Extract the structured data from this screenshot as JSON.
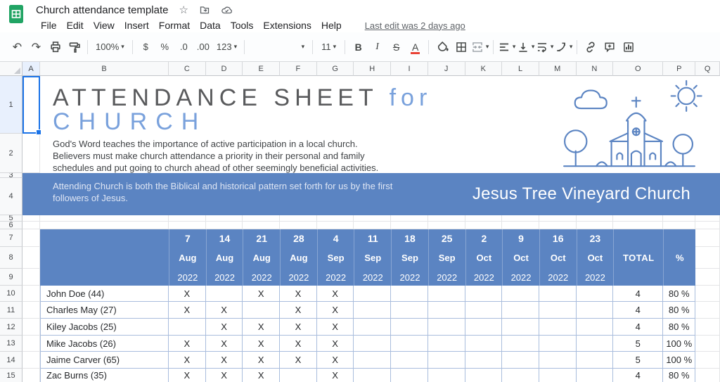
{
  "app": {
    "doc_title": "Church attendance template",
    "menu": [
      "File",
      "Edit",
      "View",
      "Insert",
      "Format",
      "Data",
      "Tools",
      "Extensions",
      "Help"
    ],
    "last_edit": "Last edit was 2 days ago"
  },
  "toolbar": {
    "undo": "↶",
    "redo": "↷",
    "zoom": "100%",
    "currency": "$",
    "percent": "%",
    "decrease_decimal": ".0",
    "increase_decimal": ".00",
    "number_format": "123",
    "font_size": "11",
    "bold": "B",
    "italic": "I",
    "strikethrough": "S",
    "text_color": "A",
    "caret": "▾",
    "star": "☆"
  },
  "grid": {
    "columns": [
      "A",
      "B",
      "C",
      "D",
      "E",
      "F",
      "G",
      "H",
      "I",
      "J",
      "K",
      "L",
      "M",
      "N",
      "O",
      "P",
      "Q"
    ],
    "rows": [
      "1",
      "2",
      "3",
      "4",
      "5",
      "6",
      "7",
      "8",
      "9",
      "10",
      "11",
      "12",
      "13",
      "14",
      "15"
    ]
  },
  "selection": {
    "column": "A",
    "row": "1"
  },
  "content": {
    "title_main": "ATTENDANCE SHEET",
    "title_accent": "for",
    "title_line2": "CHURCH",
    "description": [
      "God's Word teaches the importance of active participation in a local church.",
      "Believers must make church attendance a priority in their personal and family",
      "schedules and put going to church ahead of other seemingly beneficial activities."
    ],
    "banner": [
      "Attending Church is both the Biblical and historical pattern set forth for us by the first",
      "followers of Jesus."
    ],
    "church_name": "Jesus Tree Vineyard Church"
  },
  "table": {
    "total_label": "TOTAL",
    "percent_label": "%",
    "dates": [
      {
        "day": "7",
        "month": "Aug",
        "year": "2022"
      },
      {
        "day": "14",
        "month": "Aug",
        "year": "2022"
      },
      {
        "day": "21",
        "month": "Aug",
        "year": "2022"
      },
      {
        "day": "28",
        "month": "Aug",
        "year": "2022"
      },
      {
        "day": "4",
        "month": "Sep",
        "year": "2022"
      },
      {
        "day": "11",
        "month": "Sep",
        "year": "2022"
      },
      {
        "day": "18",
        "month": "Sep",
        "year": "2022"
      },
      {
        "day": "25",
        "month": "Sep",
        "year": "2022"
      },
      {
        "day": "2",
        "month": "Oct",
        "year": "2022"
      },
      {
        "day": "9",
        "month": "Oct",
        "year": "2022"
      },
      {
        "day": "16",
        "month": "Oct",
        "year": "2022"
      },
      {
        "day": "23",
        "month": "Oct",
        "year": "2022"
      }
    ],
    "rows": [
      {
        "name": "John Doe (44)",
        "marks": [
          "X",
          "",
          "X",
          "X",
          "X",
          "",
          "",
          "",
          "",
          "",
          "",
          ""
        ],
        "total": "4",
        "percent": "80 %"
      },
      {
        "name": "Charles May (27)",
        "marks": [
          "X",
          "X",
          "",
          "X",
          "X",
          "",
          "",
          "",
          "",
          "",
          "",
          ""
        ],
        "total": "4",
        "percent": "80 %"
      },
      {
        "name": "Kiley Jacobs (25)",
        "marks": [
          "",
          "X",
          "X",
          "X",
          "X",
          "",
          "",
          "",
          "",
          "",
          "",
          ""
        ],
        "total": "4",
        "percent": "80 %"
      },
      {
        "name": "Mike Jacobs (26)",
        "marks": [
          "X",
          "X",
          "X",
          "X",
          "X",
          "",
          "",
          "",
          "",
          "",
          "",
          ""
        ],
        "total": "5",
        "percent": "100 %"
      },
      {
        "name": "Jaime Carver (65)",
        "marks": [
          "X",
          "X",
          "X",
          "X",
          "X",
          "",
          "",
          "",
          "",
          "",
          "",
          ""
        ],
        "total": "5",
        "percent": "100 %"
      },
      {
        "name": "Zac Burns (35)",
        "marks": [
          "X",
          "X",
          "X",
          "",
          "X",
          "",
          "",
          "",
          "",
          "",
          "",
          ""
        ],
        "total": "4",
        "percent": "80 %"
      }
    ]
  },
  "colors": {
    "accent_blue": "#5b84c2",
    "title_accent_blue": "#79a1dc",
    "selection_blue": "#1a73e8",
    "logo_green": "#21a464",
    "text_color_red": "#e94235",
    "table_border_blue": "#a9bddd"
  }
}
